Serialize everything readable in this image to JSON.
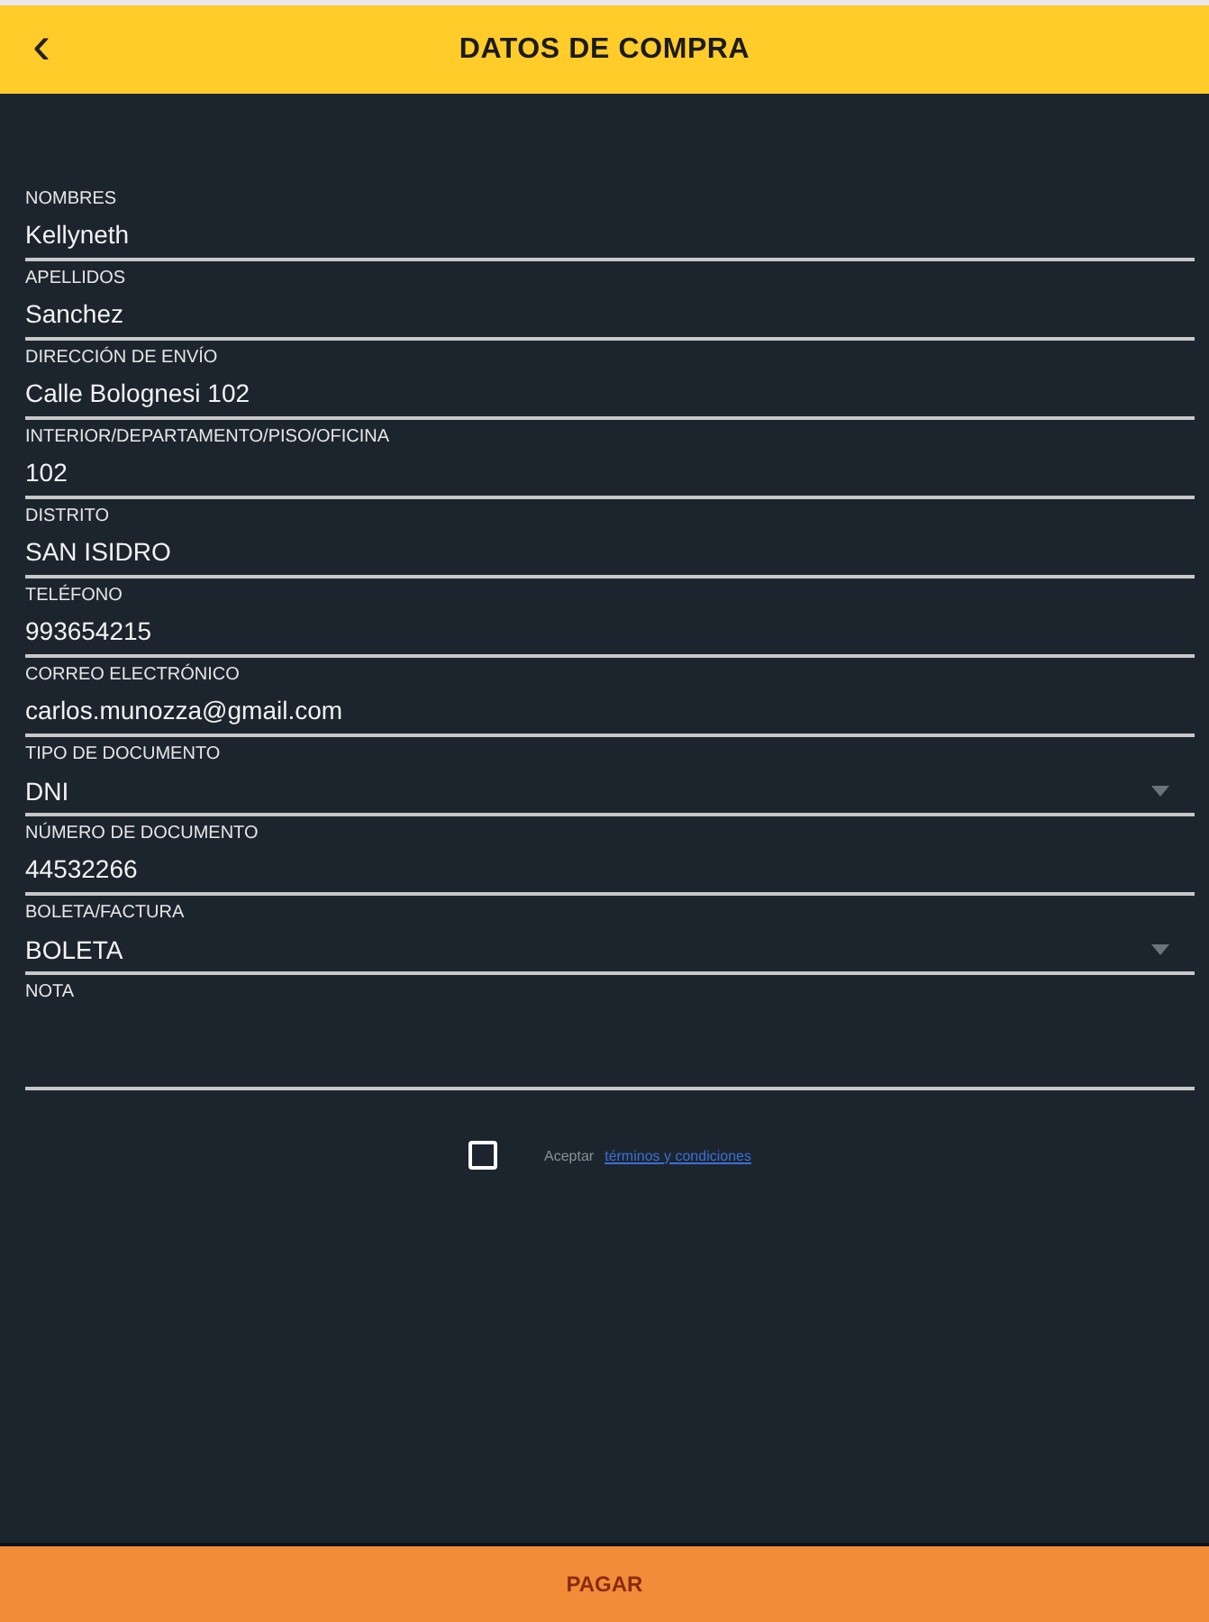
{
  "header": {
    "back_icon": "‹",
    "title": "DATOS DE COMPRA"
  },
  "fields": [
    {
      "kind": "text",
      "label": "NOMBRES",
      "value": "Kellyneth"
    },
    {
      "kind": "text",
      "label": "APELLIDOS",
      "value": "Sanchez"
    },
    {
      "kind": "text",
      "label": "DIRECCIÓN DE ENVÍO",
      "value": "Calle Bolognesi 102"
    },
    {
      "kind": "text",
      "label": "INTERIOR/DEPARTAMENTO/PISO/OFICINA",
      "value": "102"
    },
    {
      "kind": "text",
      "label": "DISTRITO",
      "value": "SAN ISIDRO"
    },
    {
      "kind": "text",
      "label": "TELÉFONO",
      "value": "993654215"
    },
    {
      "kind": "text",
      "label": "CORREO ELECTRÓNICO",
      "value": "carlos.munozza@gmail.com"
    },
    {
      "kind": "select",
      "label": "TIPO DE DOCUMENTO",
      "value": "DNI"
    },
    {
      "kind": "text",
      "label": "NÚMERO DE DOCUMENTO",
      "value": "44532266"
    },
    {
      "kind": "select",
      "label": "BOLETA/FACTURA",
      "value": "BOLETA"
    },
    {
      "kind": "textarea",
      "label": "NOTA"
    }
  ],
  "terms": {
    "checked": false,
    "text": "Aceptar",
    "link": "términos y condiciones"
  },
  "pay_button": "PAGAR"
}
